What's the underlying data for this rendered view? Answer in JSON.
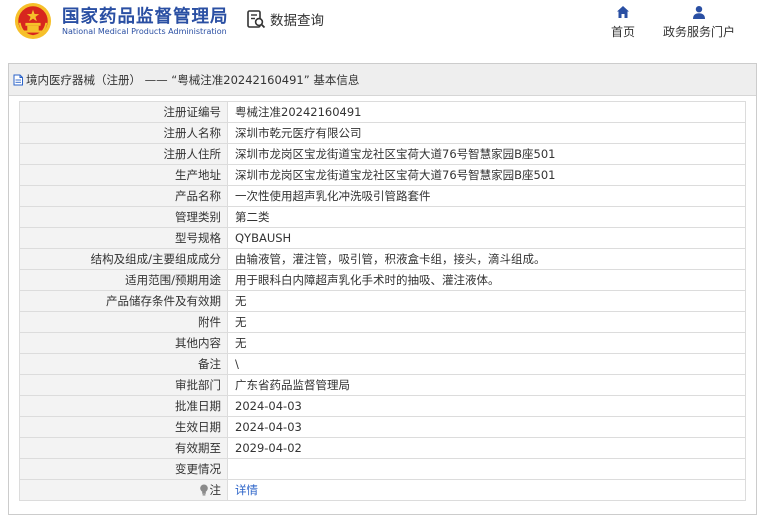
{
  "header": {
    "org_name_cn": "国家药品监督管理局",
    "org_name_en": "National Medical Products Administration",
    "query_label": "数据查询",
    "nav": {
      "home_label": "首页",
      "portal_label": "政务服务门户"
    }
  },
  "panel": {
    "title": "境内医疗器械（注册） —— “粤械注准20242160491” 基本信息"
  },
  "details": [
    {
      "label": "注册证编号",
      "value": "粤械注准20242160491"
    },
    {
      "label": "注册人名称",
      "value": "深圳市乾元医疗有限公司"
    },
    {
      "label": "注册人住所",
      "value": "深圳市龙岗区宝龙街道宝龙社区宝荷大道76号智慧家园B座501"
    },
    {
      "label": "生产地址",
      "value": "深圳市龙岗区宝龙街道宝龙社区宝荷大道76号智慧家园B座501"
    },
    {
      "label": "产品名称",
      "value": "一次性使用超声乳化冲洗吸引管路套件"
    },
    {
      "label": "管理类别",
      "value": "第二类"
    },
    {
      "label": "型号规格",
      "value": "QYBAUSH"
    },
    {
      "label": "结构及组成/主要组成成分",
      "value": "由输液管，灌注管，吸引管，积液盒卡组，接头，滴斗组成。"
    },
    {
      "label": "适用范围/预期用途",
      "value": "用于眼科白内障超声乳化手术时的抽吸、灌注液体。"
    },
    {
      "label": "产品储存条件及有效期",
      "value": "无"
    },
    {
      "label": "附件",
      "value": "无"
    },
    {
      "label": "其他内容",
      "value": "无"
    },
    {
      "label": "备注",
      "value": "\\"
    },
    {
      "label": "审批部门",
      "value": "广东省药品监督管理局"
    },
    {
      "label": "批准日期",
      "value": "2024-04-03"
    },
    {
      "label": "生效日期",
      "value": "2024-04-03"
    },
    {
      "label": "有效期至",
      "value": "2029-04-02"
    },
    {
      "label": "变更情况",
      "value": ""
    }
  ],
  "note": {
    "label": "注",
    "link_text": "详情"
  },
  "icons": {
    "emblem": "national-emblem-icon",
    "query": "data-query-icon",
    "home": "home-icon",
    "portal": "user-icon",
    "panel": "document-icon",
    "note": "lightbulb-icon"
  },
  "colors": {
    "brand_blue": "#2a4fa3",
    "link_blue": "#2a62c8",
    "label_bg": "#f3f3f3",
    "title_bar_bg": "#eeeeee",
    "emblem_red": "#d7261e",
    "emblem_gold": "#f6c02a"
  }
}
